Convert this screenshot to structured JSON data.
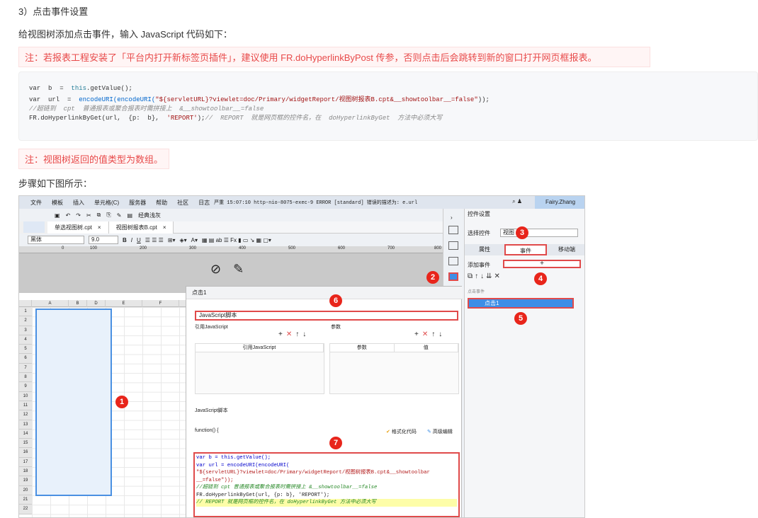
{
  "heading": "3）点击事件设置",
  "intro": "给视图树添加点击事件，输入 JavaScript 代码如下：",
  "note1": "注：若报表工程安装了「平台内打开新标签页插件」，建议使用 FR.doHyperlinkByPost 传参，否则点击后会跳转到新的窗口打开网页框报表。",
  "code": {
    "line1_a": "var  b  =  ",
    "line1_b": "this",
    "line1_c": ".getValue();",
    "line2_a": "var  url  =  ",
    "line2_b": "encodeURI(encodeURI(",
    "line2_c": "\"${servletURL}?viewlet=doc/Primary/widgetReport/视图树报表B.cpt&__showtoolbar__=false\"",
    "line2_d": "));",
    "line3": "//超链到  cpt  普通报表或聚合报表时需拼接上  &__showtoolbar__=false",
    "line4_a": "FR.doHyperlinkByGet(url,  {p:  b},  ",
    "line4_b": "'REPORT'",
    "line4_c": ");",
    "line4_d": "//  REPORT  就是网页框的控件名，在  doHyperlinkByGet  方法中必须大写"
  },
  "note2": "注：视图树返回的值类型为数组。",
  "steps": "步骤如下图所示：",
  "app": {
    "menu": [
      "文件",
      "模板",
      "插入",
      "单元格(C)",
      "服务器",
      "帮助",
      "社区",
      "日志"
    ],
    "log": "严重 15:07:10 http-nio-8075-exec-9 ERROR [standard] 错误的描述为: e.url",
    "user": "Fairy.Zhang",
    "classic": "经典浅灰",
    "tab1": "单选视图树.cpt",
    "tab2": "视图树报表B.cpt",
    "font": "黑体",
    "size": "9.0",
    "ruler": [
      "0",
      "100",
      "200",
      "300",
      "400",
      "500",
      "600",
      "700",
      "800"
    ],
    "cols": [
      "A",
      "B",
      "D",
      "E",
      "F"
    ],
    "rows": [
      "1",
      "2",
      "3",
      "4",
      "5",
      "6",
      "7",
      "8",
      "9",
      "10",
      "11",
      "12",
      "13",
      "14",
      "15",
      "16",
      "17",
      "18",
      "19",
      "20",
      "21",
      "22"
    ],
    "panel": {
      "title": "控件设置",
      "select_label": "选择控件",
      "select_value": "视图",
      "tabs": [
        "属性",
        "事件",
        "移动端"
      ],
      "add_event": "添加事件",
      "add_btn": "+",
      "evt_header": "点击事件",
      "evt_item": "点击1"
    },
    "dialog": {
      "title": "点击1",
      "type": "JavaScript脚本",
      "ref_label": "引用JavaScript",
      "param_label": "参数",
      "ref_col": "引用JavaScript",
      "param_col": "参数",
      "value_col": "值",
      "script_label": "JavaScript脚本",
      "func": "function() {",
      "fmt": "格式化代码",
      "adv": "高级编辑",
      "js": [
        "var b = this.getValue();",
        "var url = encodeURI(encodeURI(",
        "\"${servletURL}?viewlet=doc/Primary/widgetReport/视图树报表B.cpt&__showtoolbar",
        "__=false\"));",
        "//超链到 cpt 普通报表或聚合报表时需拼接上 &__showtoolbar__=false",
        "FR.doHyperlinkByGet(url, {p: b}, 'REPORT');",
        "// REPORT 就是网页框的控件名，在 doHyperlinkByGet 方法中必须大写"
      ]
    },
    "badges": [
      "1",
      "2",
      "3",
      "4",
      "5",
      "6",
      "7"
    ]
  }
}
